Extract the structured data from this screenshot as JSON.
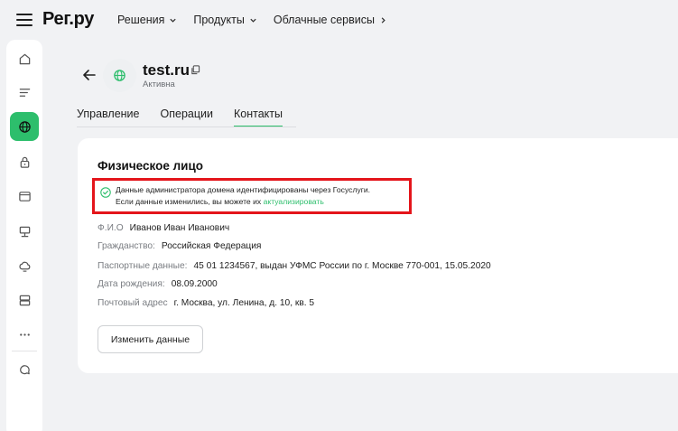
{
  "header": {
    "logo": "Рег.ру",
    "nav": [
      {
        "label": "Решения",
        "chevron": "chevron-down-icon"
      },
      {
        "label": "Продукты",
        "chevron": "chevron-down-icon"
      },
      {
        "label": "Облачные сервисы",
        "chevron": "chevron-right-icon"
      }
    ]
  },
  "sidebar": {
    "items": [
      {
        "icon": "home-icon",
        "active": false
      },
      {
        "icon": "list-icon",
        "active": false
      },
      {
        "icon": "globe-icon",
        "active": true
      },
      {
        "icon": "lock-icon",
        "active": false
      },
      {
        "icon": "browser-window-icon",
        "active": false
      },
      {
        "icon": "server-icon",
        "active": false
      },
      {
        "icon": "cloud-icon",
        "active": false
      },
      {
        "icon": "database-icon",
        "active": false
      },
      {
        "icon": "more-icon",
        "active": false
      },
      {
        "icon": "support-icon",
        "active": false
      }
    ]
  },
  "domain": {
    "name": "test.ru",
    "status": "Активна"
  },
  "tabs": [
    {
      "label": "Управление",
      "active": false
    },
    {
      "label": "Операции",
      "active": false
    },
    {
      "label": "Контакты",
      "active": true
    }
  ],
  "card": {
    "title": "Физическое лицо",
    "notice": {
      "line1": "Данные администратора домена идентифицированы через Госуслуги.",
      "line2_prefix": "Если данные изменились, вы можете их ",
      "link": "актуализировать"
    },
    "fields": [
      {
        "label": "Ф.И.О",
        "value": "Иванов Иван Иванович"
      },
      {
        "label": "Гражданство:",
        "value": "Российская Федерация"
      },
      {
        "label": "Паспортные данные:",
        "value": "45 01 1234567, выдан УФМС России по г. Москве 770-001, 15.05.2020"
      },
      {
        "label": "Дата рождения:",
        "value": "08.09.2000"
      },
      {
        "label": "Почтовый адрес",
        "value": "г. Москва, ул. Ленина, д. 10, кв. 5"
      }
    ],
    "button": "Изменить данные"
  },
  "colors": {
    "accent": "#2dbe6c",
    "highlight_border": "#e4151b",
    "background": "#f1f2f4"
  }
}
